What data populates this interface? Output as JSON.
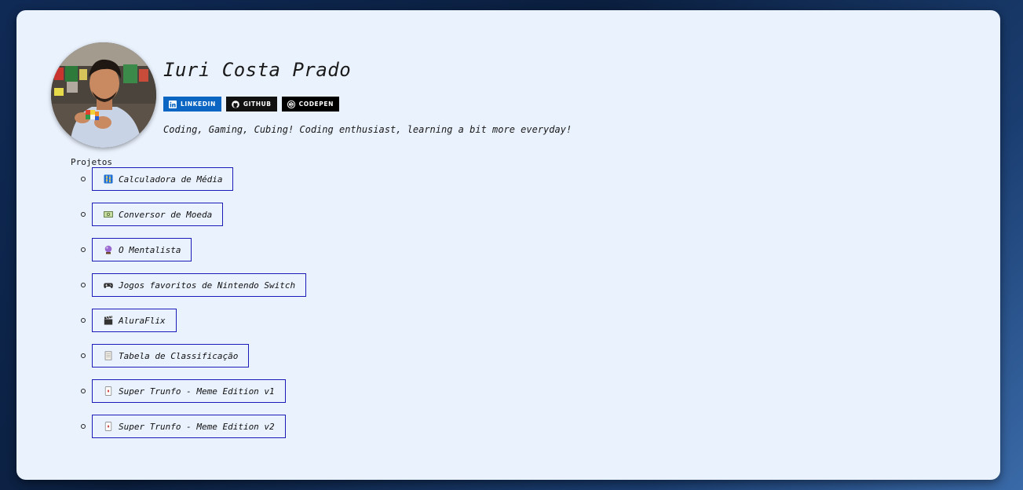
{
  "profile": {
    "name": "Iuri Costa Prado",
    "bio": "Coding, Gaming, Cubing! Coding enthusiast, learning a bit more everyday!"
  },
  "badges": [
    {
      "label": "LINKEDIN",
      "icon": "linkedin-icon",
      "color": "#0a66c2"
    },
    {
      "label": "GITHUB",
      "icon": "github-icon",
      "color": "#111111"
    },
    {
      "label": "CODEPEN",
      "icon": "codepen-icon",
      "color": "#000000"
    }
  ],
  "projects": {
    "title": "Projetos",
    "items": [
      {
        "label": "Calculadora de Média",
        "icon": "abacus-icon"
      },
      {
        "label": "Conversor de Moeda",
        "icon": "banknote-icon"
      },
      {
        "label": "O Mentalista",
        "icon": "crystal-ball-icon"
      },
      {
        "label": "Jogos favoritos de Nintendo Switch",
        "icon": "gamepad-icon"
      },
      {
        "label": "AluraFlix",
        "icon": "clapperboard-icon"
      },
      {
        "label": "Tabela de Classificação",
        "icon": "scroll-icon"
      },
      {
        "label": "Super Trunfo - Meme Edition v1",
        "icon": "playing-card-icon"
      },
      {
        "label": "Super Trunfo - Meme Edition v2",
        "icon": "playing-card-icon"
      }
    ]
  },
  "colors": {
    "card_bg": "#eaf2fe",
    "link_border": "#1b1bb8",
    "linkedin": "#0a66c2"
  }
}
